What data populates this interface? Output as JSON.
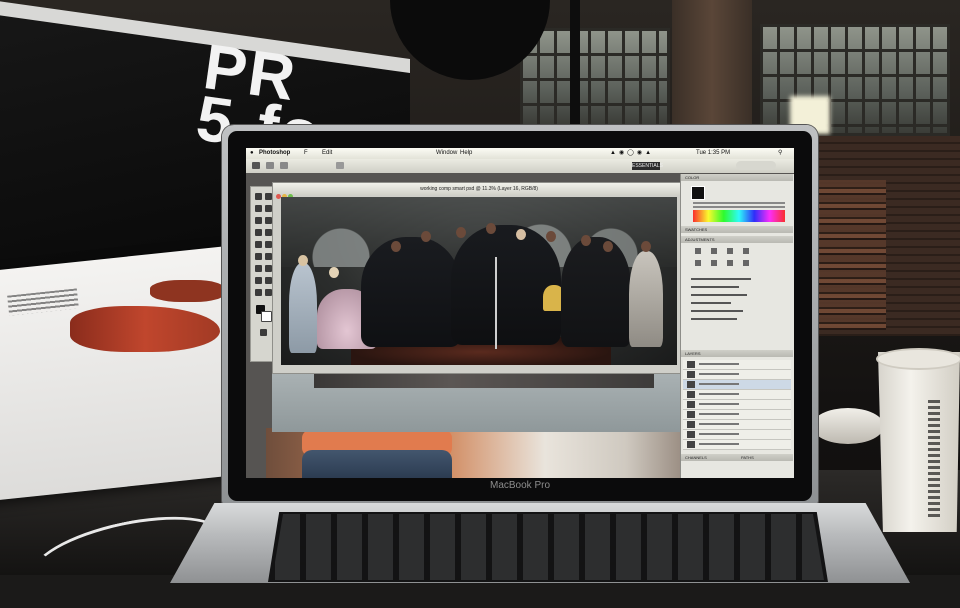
{
  "scene": {
    "softbox_print": "PR\n5-fo",
    "laptop_brand": "MacBook Pro"
  },
  "photoshop": {
    "menu": {
      "app": "Photoshop",
      "file": "F",
      "edit": "Edit",
      "window": "Window",
      "help": "Help",
      "status_right": "Tue 1:35 PM"
    },
    "workspace_button": "ESSENTIALS",
    "document_title": "working comp smart psd @ 11.3% (Layer 16, RGB/8)",
    "panel_headers": [
      "COLOR",
      "SWATCHES",
      "ADJUSTMENTS",
      "LAYERS",
      "CHANNELS",
      "PATHS"
    ]
  },
  "colors": {
    "menubar": "#f2f2ea",
    "panel_bg": "#e7e7e1",
    "cup": "#efece5"
  }
}
